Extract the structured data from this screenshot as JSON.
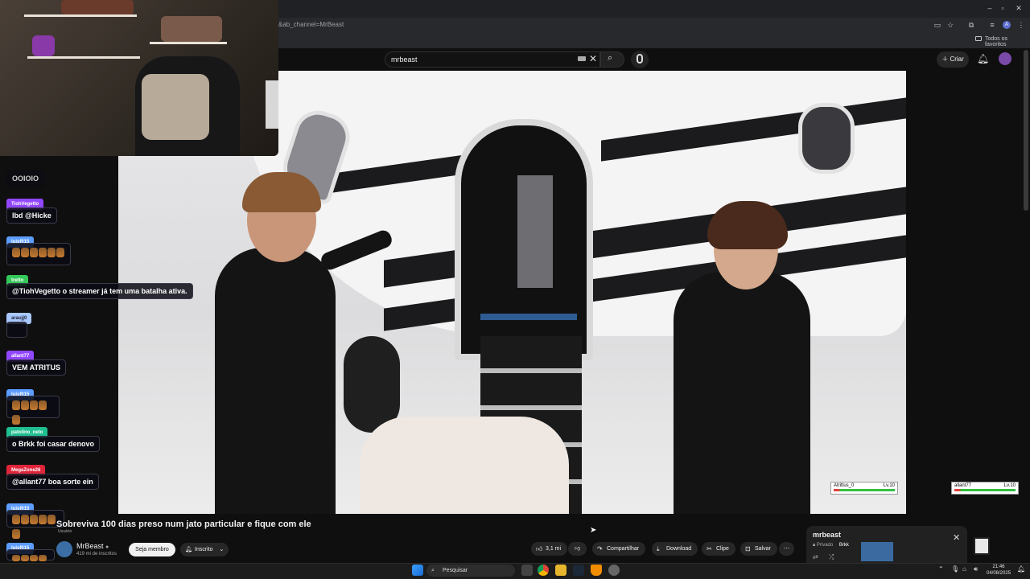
{
  "browser": {
    "url_fragment": "&ab_channel=MrBeast",
    "bookmarks_label": "Todos os favoritos"
  },
  "youtube": {
    "search_query": "mrbeast",
    "create_label": "Criar",
    "video_title": "Sobreviva 100 dias preso num jato particular e fique com ele",
    "channel_name": "MrBeast",
    "subscribers": "419 mi de inscritos",
    "join_label": "Seja membro",
    "subscribed_label": "Inscrito",
    "likes": "3,1 mi",
    "share_label": "Compartilhar",
    "download_label": "Download",
    "clip_label": "Clipe",
    "save_label": "Salvar",
    "mini_panel_title": "mrbeast",
    "mini_panel_sub": "Privado",
    "mini_panel_user": "Brkk"
  },
  "overlay_cards": [
    {
      "name": "Atrittus_0",
      "level": "Lv.10"
    },
    {
      "name": "allant77",
      "level": "Lv.10"
    }
  ],
  "chat": {
    "top_partial_text": "OOIOIO",
    "messages": [
      {
        "user": "TiohVegetto",
        "color": "#9146ff",
        "text": "lbd @Hicke"
      },
      {
        "user": "luisf015",
        "color": "#5c9dff",
        "text": ""
      },
      {
        "user": "tretto",
        "color": "#34c759",
        "text": "@TiohVegetto o streamer já tem uma batalha ativa."
      },
      {
        "user": "araujj0",
        "color": "#a8c8ff",
        "text": ""
      },
      {
        "user": "allant77",
        "color": "#9146ff",
        "text": "VEM ATRITUS"
      },
      {
        "user": "luisf015",
        "color": "#5c9dff",
        "text": ""
      },
      {
        "user": "patolino_neto",
        "color": "#1fbf8f",
        "text": "o Brkk foi casar denovo"
      },
      {
        "user": "MegaZone26",
        "color": "#e0243a",
        "text": "@allant77 boa sorte ein"
      },
      {
        "user": "luisf015",
        "color": "#5c9dff",
        "text": ""
      },
      {
        "user": "luisf015",
        "color": "#5c9dff",
        "text": ""
      }
    ],
    "tag_under": "Usuário"
  },
  "taskbar": {
    "search_label": "Pesquisar",
    "time": "21:46",
    "date": "04/08/2025"
  }
}
